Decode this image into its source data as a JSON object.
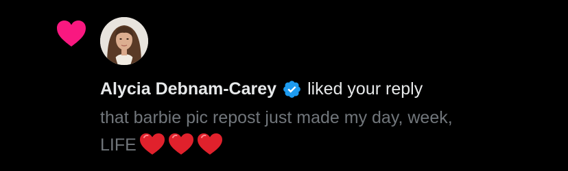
{
  "notification": {
    "type_icon": "heart-icon",
    "avatar_icon": "user-avatar",
    "author": {
      "name": "Alycia Debnam-Carey",
      "verified_icon": "verified-badge-icon"
    },
    "action": "liked your reply",
    "reply": {
      "line1": "that barbie pic repost just made my day, week,",
      "line2": "LIFE",
      "emoji_icons": [
        "red-heart-emoji",
        "red-heart-emoji",
        "red-heart-emoji"
      ]
    }
  },
  "colors": {
    "background": "#000000",
    "like_heart": "#f91880",
    "verified_blue": "#1d9bf0",
    "primary_text": "#e7e9ea",
    "secondary_text": "#71767b",
    "emoji_heart": "#e0212c"
  }
}
